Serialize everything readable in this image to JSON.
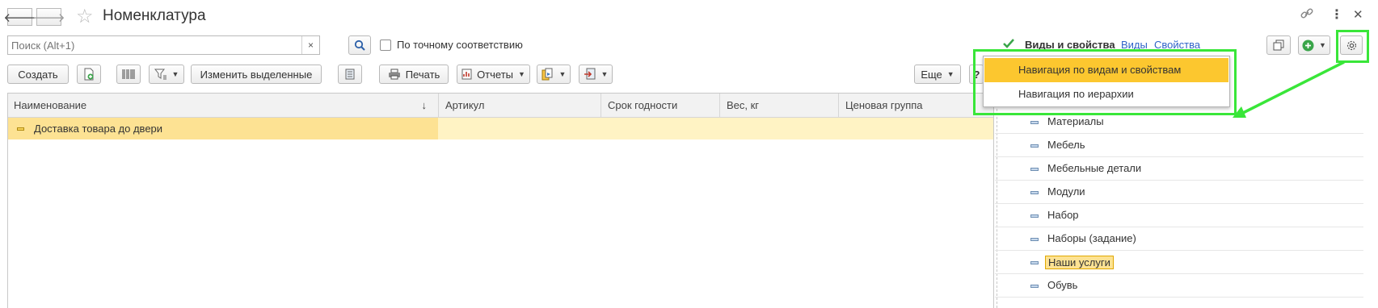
{
  "window": {
    "title": "Номенклатура",
    "back_icon": "arrow-left-icon",
    "forward_icon": "arrow-right-icon",
    "favorite_icon": "star-icon",
    "link_icon": "link-icon",
    "more_icon": "more-vertical-icon",
    "close_icon": "close-icon"
  },
  "search": {
    "placeholder": "Поиск (Alt+1)",
    "clear_glyph": "×",
    "exact_match_label": "По точному соответствию"
  },
  "toolbar": {
    "create": "Создать",
    "edit_selected": "Изменить выделенные",
    "print": "Печать",
    "reports": "Отчеты",
    "more": "Еще"
  },
  "table": {
    "columns": [
      "Наименование",
      "Артикул",
      "Срок годности",
      "Вес, кг",
      "Ценовая группа"
    ],
    "sort_glyph": "↓",
    "rows": [
      {
        "name": "Доставка товара до двери",
        "article": "",
        "shelf_life": "",
        "weight": "",
        "price_group": ""
      }
    ]
  },
  "right_panel": {
    "checkbox_label": "Виды и свойства",
    "link_kinds": "Виды",
    "link_props": "Свойства",
    "items": [
      "Материалы",
      "Мебель",
      "Мебельные детали",
      "Модули",
      "Набор",
      "Наборы (задание)",
      "Наши услуги",
      "Обувь"
    ],
    "selected_item": "Наши услуги"
  },
  "dropdown_menu": {
    "items": [
      "Навигация по видам и свойствам",
      "Навигация по иерархии"
    ],
    "highlighted_item": "Навигация по видам и свойствам"
  },
  "colors": {
    "selection_yellow": "#fde293",
    "menu_highlight": "#fcc72f",
    "annotation_green": "#39e639",
    "link_blue": "#2f63c8"
  }
}
